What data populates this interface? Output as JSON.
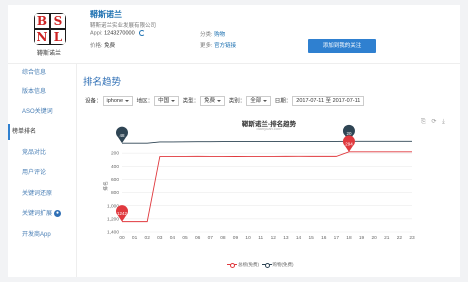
{
  "app": {
    "name": "鞯斯诺兰",
    "sidebar_name": "鞯斯诺兰",
    "company": "鞯斯诺兰实业发展有限公司",
    "appid_label": "Appi:",
    "appid_value": "1243270000",
    "price_label": "价格:",
    "price_value": "免费",
    "category_label": "分类:",
    "category_value": "购物",
    "more_label": "更多:",
    "more_value": "官方链接",
    "follow_button": "添加到我的关注",
    "icon_letters": [
      "B",
      "S",
      "N",
      "L"
    ]
  },
  "sidebar": {
    "items": [
      {
        "label": "综合信息",
        "active": false
      },
      {
        "label": "版本信息",
        "active": false
      },
      {
        "label": "ASO关键词",
        "active": false
      },
      {
        "label": "榜单排名",
        "active": true
      },
      {
        "label": "竞品对比",
        "active": false
      },
      {
        "label": "用户评论",
        "active": false
      },
      {
        "label": "关键词还原",
        "active": false
      },
      {
        "label": "关键词扩展",
        "active": false,
        "badge": "●"
      },
      {
        "label": "开发商App",
        "active": false
      }
    ]
  },
  "section_title": "排名趋势",
  "filters": {
    "device_label": "设备：",
    "device_value": "iphone",
    "region_label": "地区：",
    "region_value": "中国",
    "type_label": "类型：",
    "type_value": "免费",
    "category_label": "类别：",
    "category_value": "全部",
    "date_label": "日期：",
    "date_value": "2017-07-11 至 2017-07-11"
  },
  "chart_data": {
    "type": "line",
    "title": "鞯斯诺兰-排名趋势",
    "subtitle": "dianyuan.com",
    "tools": "⎘ ⟳ ⤓",
    "ylabel": "排名",
    "x": [
      "00",
      "01",
      "02",
      "03",
      "04",
      "05",
      "06",
      "07",
      "08",
      "09",
      "10",
      "11",
      "12",
      "13",
      "14",
      "15",
      "16",
      "17",
      "18",
      "19",
      "20",
      "21",
      "22",
      "23"
    ],
    "y_ticks": [
      200,
      400,
      600,
      800,
      1000,
      1200,
      1400
    ],
    "y_tick_labels": [
      "200",
      "400",
      "600",
      "800",
      "1,000",
      "1,200",
      "1,400"
    ],
    "ylim": [
      1400,
      0
    ],
    "series": [
      {
        "name": "总榜(免费)",
        "color": "#e0393e",
        "values": [
          1242,
          1242,
          1242,
          252,
          252,
          250,
          249,
          250,
          250,
          251,
          250,
          250,
          250,
          249,
          248,
          249,
          249,
          249,
          180,
          180,
          180,
          180,
          180,
          180
        ]
      },
      {
        "name": "购物(免费)",
        "color": "#2f4554",
        "values": [
          48,
          48,
          48,
          30,
          30,
          28,
          25,
          25,
          24,
          24,
          24,
          24,
          24,
          22,
          22,
          22,
          22,
          22,
          20,
          20,
          20,
          20,
          20,
          20
        ]
      }
    ],
    "pins": [
      {
        "series": 1,
        "x_index": 0,
        "label": "48"
      },
      {
        "series": 0,
        "x_index": 0,
        "label": "1242"
      },
      {
        "series": 1,
        "x_index": 18,
        "label": "20"
      },
      {
        "series": 0,
        "x_index": 18,
        "label": "294"
      }
    ]
  }
}
